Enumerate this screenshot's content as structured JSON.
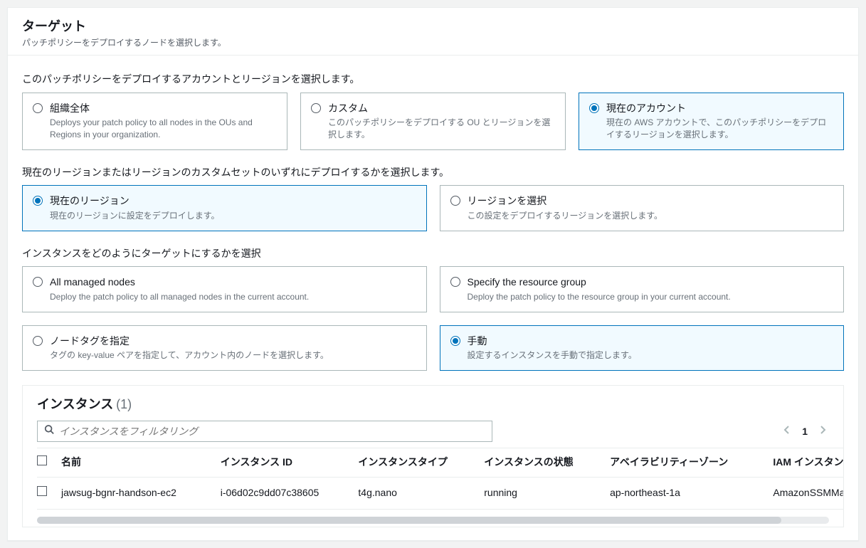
{
  "header": {
    "title": "ターゲット",
    "description": "パッチポリシーをデプロイするノードを選択します。"
  },
  "account_region_section": {
    "label": "このパッチポリシーをデプロイするアカウントとリージョンを選択します。",
    "options": [
      {
        "title": "組織全体",
        "desc": "Deploys your patch policy to all nodes in the OUs and Regions in your organization."
      },
      {
        "title": "カスタム",
        "desc": "このパッチポリシーをデプロイする OU とリージョンを選択します。"
      },
      {
        "title": "現在のアカウント",
        "desc": "現在の AWS アカウントで、このパッチポリシーをデプロイするリージョンを選択します。"
      }
    ],
    "selected_index": 2
  },
  "region_section": {
    "label": "現在のリージョンまたはリージョンのカスタムセットのいずれにデプロイするかを選択します。",
    "options": [
      {
        "title": "現在のリージョン",
        "desc": "現在のリージョンに設定をデプロイします。"
      },
      {
        "title": "リージョンを選択",
        "desc": "この設定をデプロイするリージョンを選択します。"
      }
    ],
    "selected_index": 0
  },
  "target_method_section": {
    "label": "インスタンスをどのようにターゲットにするかを選択",
    "options": [
      {
        "title": "All managed nodes",
        "desc": "Deploy the patch policy to all managed nodes in the current account."
      },
      {
        "title": "Specify the resource group",
        "desc": "Deploy the patch policy to the resource group in your current account."
      },
      {
        "title": "ノードタグを指定",
        "desc": "タグの key-value ペアを指定して、アカウント内のノードを選択します。"
      },
      {
        "title": "手動",
        "desc": "設定するインスタンスを手動で指定します。"
      }
    ],
    "selected_index": 3
  },
  "instances": {
    "title": "インスタンス",
    "count_display": "(1)",
    "search_placeholder": "インスタンスをフィルタリング",
    "page": "1",
    "columns": [
      "名前",
      "インスタンス ID",
      "インスタンスタイプ",
      "インスタンスの状態",
      "アベイラビリティーゾーン",
      "IAM インスタンス"
    ],
    "rows": [
      {
        "name": "jawsug-bgnr-handson-ec2",
        "instance_id": "i-06d02c9dd07c38605",
        "type": "t4g.nano",
        "state": "running",
        "az": "ap-northeast-1a",
        "iam": "AmazonSSMMana"
      }
    ]
  }
}
